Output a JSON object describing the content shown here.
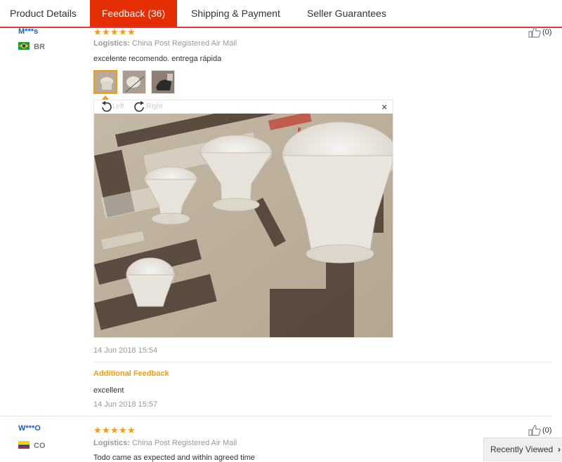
{
  "tabs": [
    {
      "label": "Product Details",
      "active": false
    },
    {
      "label": "Feedback (36)",
      "active": true
    },
    {
      "label": "Shipping & Payment",
      "active": false
    },
    {
      "label": "Seller Guarantees",
      "active": false
    }
  ],
  "colors": {
    "accent": "#e62e04",
    "star": "#f39c12",
    "user": "#1a5cc8"
  },
  "feedback": [
    {
      "user": "M***s",
      "country": "BR",
      "flag": "brazil-flag",
      "rating": 5,
      "logistics_label": "Logistics:",
      "logistics": "China Post Registered Air Mail",
      "text": "excelente recomendo. entrega rápida",
      "helpful_count": "(0)",
      "viewer": {
        "left_label": "Left",
        "right_label": "Right",
        "close": "×"
      },
      "date": "14 Jun 2018 15:54",
      "additional_label": "Additional Feedback",
      "additional_text": "excellent",
      "additional_date": "14 Jun 2018 15:57"
    },
    {
      "user": "W***O",
      "country": "CO",
      "flag": "colombia-flag",
      "rating": 5,
      "logistics_label": "Logistics:",
      "logistics": "China Post Registered Air Mail",
      "text": "Todo came as expected and within agreed time",
      "helpful_count": "(0)"
    }
  ],
  "recently_viewed": {
    "label": "Recently Viewed",
    "icon": "chevron-right-icon"
  }
}
